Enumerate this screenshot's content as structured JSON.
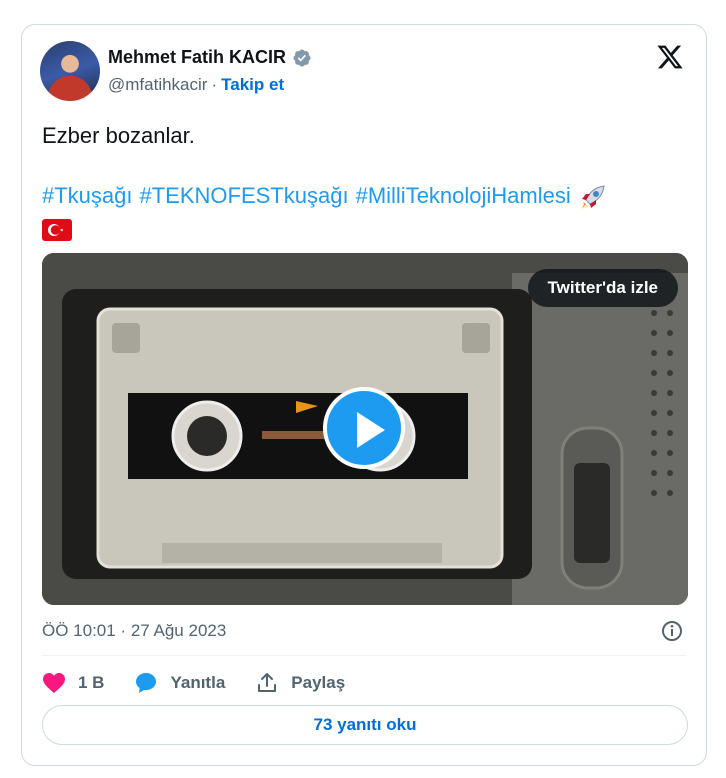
{
  "author": {
    "name": "Mehmet Fatih KACIR",
    "handle": "@mfatihkacir",
    "separator": "·",
    "follow_label": "Takip et"
  },
  "tweet": {
    "text": "Ezber bozanlar.",
    "hashtags": [
      "#Tkuşağı",
      "#TEKNOFESTkuşağı",
      "#MilliTeknolojiHamlesi"
    ]
  },
  "media": {
    "watch_label": "Twitter'da izle"
  },
  "meta": {
    "timestamp": "ÖÖ 10:01 · 27 Ağu 2023"
  },
  "actions": {
    "like_count": "1 B",
    "reply_label": "Yanıtla",
    "share_label": "Paylaş"
  },
  "footer": {
    "read_replies_label": "73 yanıtı oku"
  },
  "colors": {
    "accent": "#1d9bf0",
    "link": "#006fd6",
    "like": "#f91880",
    "muted": "#536471"
  }
}
